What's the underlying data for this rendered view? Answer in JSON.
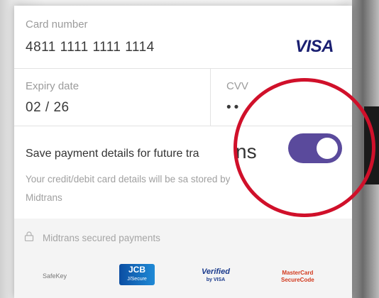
{
  "card": {
    "number_label": "Card number",
    "number_value": "4811 1111 1111 1114",
    "brand": "VISA",
    "expiry_label": "Expiry date",
    "expiry_value": "02 / 26",
    "cvv_label": "CVV",
    "cvv_value": "••"
  },
  "save": {
    "title": "Save payment details for future tra",
    "title_tail": "ns",
    "description": "Your credit/debit card details will be sa stored by Midtrans",
    "toggle_on": true
  },
  "footer": {
    "secured_text": "Midtrans secured payments",
    "logos": {
      "safekey": "SafeKey",
      "jcb": "JCB",
      "jcb_sub": "J/Secure",
      "vbv": "Verified",
      "vbv_sub": "by VISA",
      "mastercard": "MasterCard",
      "mastercard_sub": "SecureCode"
    }
  },
  "colors": {
    "toggle": "#5a4a9c",
    "highlight_circle": "#d0102a",
    "visa": "#1a1f71"
  }
}
